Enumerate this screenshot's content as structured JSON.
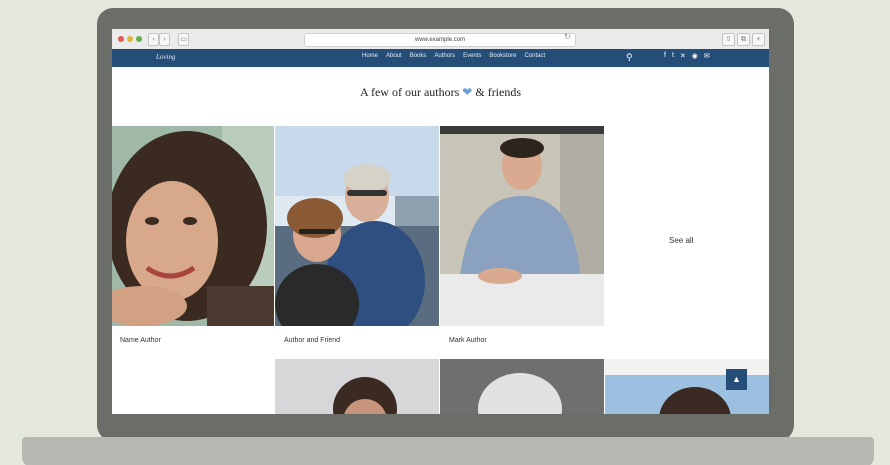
{
  "browser": {
    "url": "www.example.com",
    "back_icon": "‹",
    "forward_icon": "›",
    "sidebar_icon": "▭",
    "reload_icon": "↻",
    "share_icon": "⇧",
    "tabs_icon": "⧉",
    "plus_icon": "+"
  },
  "site": {
    "logo": "Loving",
    "menu": [
      "Home",
      "About",
      "Books",
      "Authors",
      "Events",
      "Bookstore",
      "Contact"
    ],
    "search_icon": "⚲",
    "social": [
      "f",
      "t",
      "✕",
      "◉",
      "✉"
    ]
  },
  "section": {
    "heading_part1": "A few of our authors",
    "heart": "❤",
    "heading_part2": "& friends",
    "see_all": "See all"
  },
  "people": [
    {
      "label": "Name Author"
    },
    {
      "label": "Author and Friend"
    },
    {
      "label": "Mark Author"
    }
  ],
  "back_to_top_icon": "▲",
  "colors": {
    "nav": "#244d78",
    "accent": "#6aa2d9"
  }
}
